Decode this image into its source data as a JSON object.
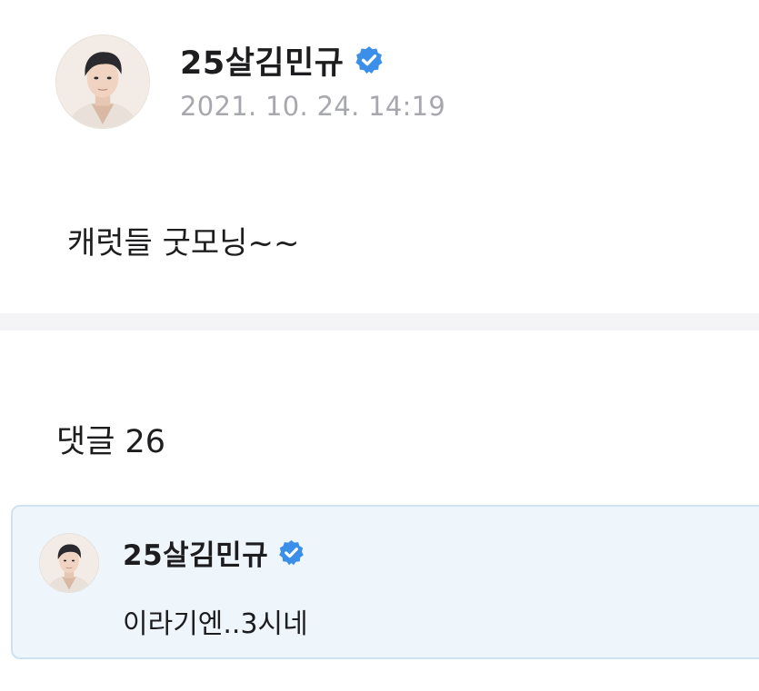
{
  "post": {
    "author": "25살김민규",
    "timestamp": "2021. 10. 24. 14:19",
    "body": "캐럿들 굿모닝~~",
    "avatar_icon": "profile-photo",
    "verified_icon": "verified-badge-icon"
  },
  "comments": {
    "header": "댓글 26",
    "items": [
      {
        "author": "25살김민규",
        "text": "이라기엔..3시네",
        "avatar_icon": "profile-photo",
        "verified_icon": "verified-badge-icon"
      }
    ]
  },
  "colors": {
    "verified": "#3b8fe9",
    "timestamp": "#a7a8ad",
    "separator": "#f4f4f6",
    "comment_bg": "#eef6fc",
    "comment_border": "#cde3f2"
  }
}
